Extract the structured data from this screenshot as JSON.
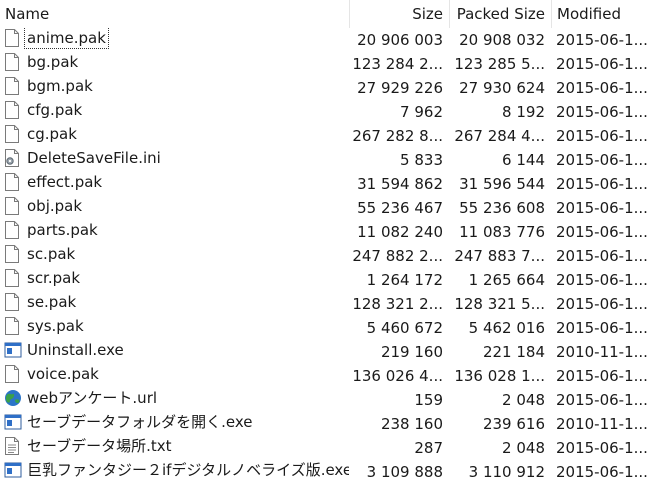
{
  "columns": {
    "name": "Name",
    "size": "Size",
    "packed_size": "Packed Size",
    "modified": "Modified"
  },
  "files": [
    {
      "name": "anime.pak",
      "size": "20 906 003",
      "packed": "20 908 032",
      "modified": "2015-06-1...",
      "icon": "file-icon"
    },
    {
      "name": "bg.pak",
      "size": "123 284 2...",
      "packed": "123 285 5...",
      "modified": "2015-06-1...",
      "icon": "file-icon"
    },
    {
      "name": "bgm.pak",
      "size": "27 929 226",
      "packed": "27 930 624",
      "modified": "2015-06-1...",
      "icon": "file-icon"
    },
    {
      "name": "cfg.pak",
      "size": "7 962",
      "packed": "8 192",
      "modified": "2015-06-1...",
      "icon": "file-icon"
    },
    {
      "name": "cg.pak",
      "size": "267 282 8...",
      "packed": "267 284 4...",
      "modified": "2015-06-1...",
      "icon": "file-icon"
    },
    {
      "name": "DeleteSaveFile.ini",
      "size": "5 833",
      "packed": "6 144",
      "modified": "2015-06-1...",
      "icon": "settings-file-icon"
    },
    {
      "name": "effect.pak",
      "size": "31 594 862",
      "packed": "31 596 544",
      "modified": "2015-06-1...",
      "icon": "file-icon"
    },
    {
      "name": "obj.pak",
      "size": "55 236 467",
      "packed": "55 236 608",
      "modified": "2015-06-1...",
      "icon": "file-icon"
    },
    {
      "name": "parts.pak",
      "size": "11 082 240",
      "packed": "11 083 776",
      "modified": "2015-06-1...",
      "icon": "file-icon"
    },
    {
      "name": "sc.pak",
      "size": "247 882 2...",
      "packed": "247 883 7...",
      "modified": "2015-06-1...",
      "icon": "file-icon"
    },
    {
      "name": "scr.pak",
      "size": "1 264 172",
      "packed": "1 265 664",
      "modified": "2015-06-1...",
      "icon": "file-icon"
    },
    {
      "name": "se.pak",
      "size": "128 321 2...",
      "packed": "128 321 5...",
      "modified": "2015-06-1...",
      "icon": "file-icon"
    },
    {
      "name": "sys.pak",
      "size": "5 460 672",
      "packed": "5 462 016",
      "modified": "2015-06-1...",
      "icon": "file-icon"
    },
    {
      "name": "Uninstall.exe",
      "size": "219 160",
      "packed": "221 184",
      "modified": "2010-11-1...",
      "icon": "exe-icon"
    },
    {
      "name": "voice.pak",
      "size": "136 026 4...",
      "packed": "136 028 1...",
      "modified": "2015-06-1...",
      "icon": "file-icon"
    },
    {
      "name": "webアンケート.url",
      "size": "159",
      "packed": "2 048",
      "modified": "2015-06-1...",
      "icon": "globe-icon"
    },
    {
      "name": "セーブデータフォルダを開く.exe",
      "size": "238 160",
      "packed": "239 616",
      "modified": "2010-11-1...",
      "icon": "exe-icon"
    },
    {
      "name": "セーブデータ場所.txt",
      "size": "287",
      "packed": "2 048",
      "modified": "2015-06-1...",
      "icon": "text-file-icon"
    },
    {
      "name": "巨乳ファンタジー２ifデジタルノベライズ版.exe",
      "size": "3 109 888",
      "packed": "3 110 912",
      "modified": "2015-06-1...",
      "icon": "exe-icon"
    }
  ]
}
